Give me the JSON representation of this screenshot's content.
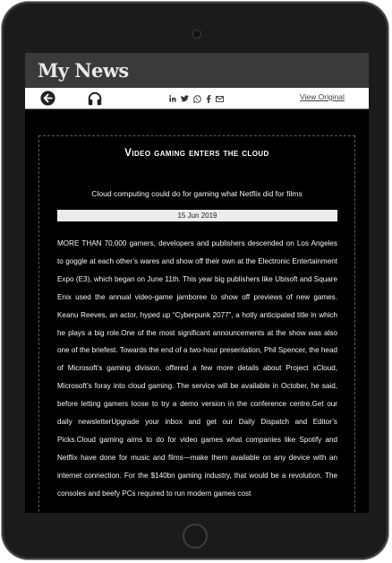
{
  "app": {
    "title": "My News"
  },
  "toolbar": {
    "back_icon": "back-arrow-icon",
    "audio_icon": "headphones-icon",
    "share_icons": [
      "linkedin-icon",
      "twitter-icon",
      "whatsapp-icon",
      "facebook-icon",
      "email-icon"
    ],
    "view_original_label": "View Original"
  },
  "article": {
    "headline": "Video gaming enters the cloud",
    "subtitle": "Cloud computing could do for gaming what Netflix did for films",
    "date": "15 Jun 2019",
    "body": "MORE THAN 70,000 gamers, developers and publishers descended on Los Angeles to goggle at each other’s wares and show off their own at the Electronic Entertainment Expo (E3), which began on June 11th. This year big publishers like Ubisoft and Square Enix used the annual video-game jamboree to show off previews of new games. Keanu Reeves, an actor, hyped up “Cyberpunk 2077”, a hotly anticipated title in which he plays a big role.One of the most significant announcements at the show was also one of the briefest. Towards the end of a two-hour presentation, Phil Spencer, the head of Microsoft’s gaming division, offered a few more details about Project xCloud, Microsoft’s foray into cloud gaming. The service will be available in October, he said, before letting gamers loose to try a demo version in the conference centre.Get our daily newsletterUpgrade your inbox and get our Daily Dispatch and Editor’s Picks.Cloud gaming aims to do for video games what companies like Spotify and Netflix have done for music and films—make them available on any device with an internet connection. For the $140bn gaming industry, that would be a revolution. The consoles and beefy PCs required to run modern games cost"
  },
  "colors": {
    "tablet_bezel": "#1b1b1b",
    "header_bg": "#3a3a3a",
    "screen_bg": "#000000",
    "date_bar_bg": "#ececec"
  }
}
